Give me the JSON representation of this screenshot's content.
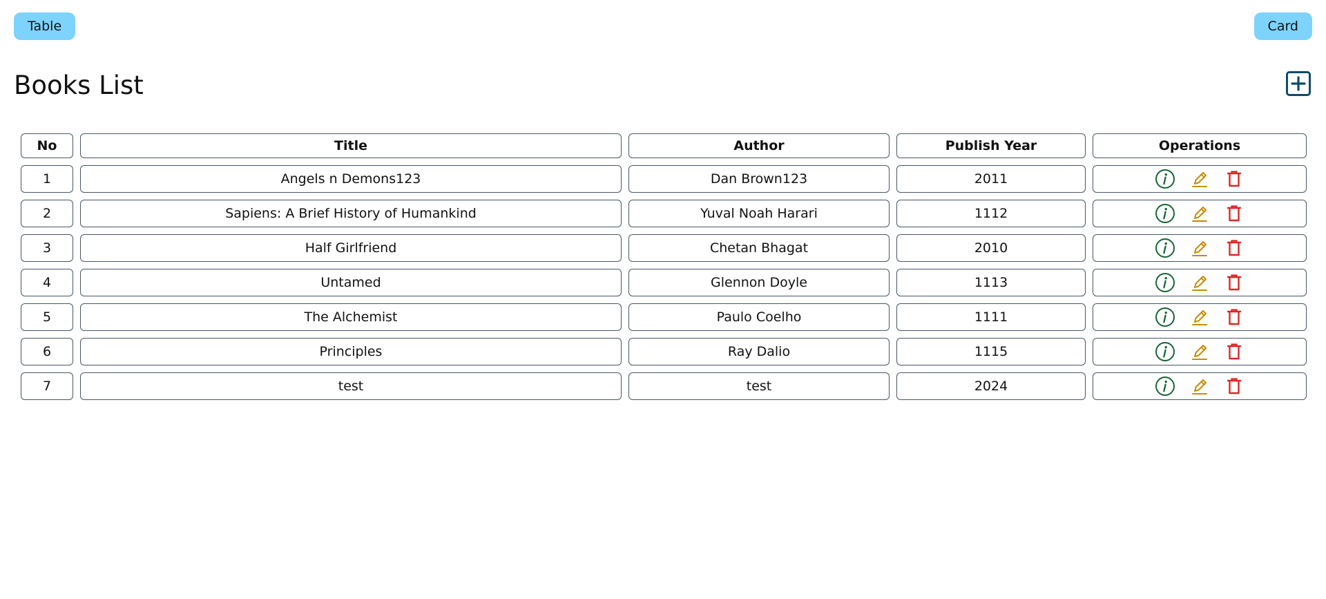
{
  "header": {
    "table_button": "Table",
    "card_button": "Card",
    "title": "Books List"
  },
  "colors": {
    "toggle_button_bg": "#7dd3fc",
    "add_icon": "#0c4a6e",
    "info_icon": "#166534",
    "edit_icon": "#ca8a04",
    "delete_icon": "#dc2626",
    "cell_border": "#475569"
  },
  "icons": {
    "add": "plus-square-icon",
    "info": "info-circle-icon",
    "edit": "pencil-icon",
    "delete": "trash-icon"
  },
  "table": {
    "columns": [
      "No",
      "Title",
      "Author",
      "Publish Year",
      "Operations"
    ],
    "rows": [
      {
        "no": "1",
        "title": "Angels n Demons123",
        "author": "Dan Brown123",
        "year": "2011"
      },
      {
        "no": "2",
        "title": "Sapiens: A Brief History of Humankind",
        "author": "Yuval Noah Harari",
        "year": "1112"
      },
      {
        "no": "3",
        "title": "Half Girlfriend",
        "author": "Chetan Bhagat",
        "year": "2010"
      },
      {
        "no": "4",
        "title": "Untamed",
        "author": "Glennon Doyle",
        "year": "1113"
      },
      {
        "no": "5",
        "title": "The Alchemist",
        "author": "Paulo Coelho",
        "year": "1111"
      },
      {
        "no": "6",
        "title": "Principles",
        "author": "Ray Dalio",
        "year": "1115"
      },
      {
        "no": "7",
        "title": "test",
        "author": "test",
        "year": "2024"
      }
    ]
  }
}
